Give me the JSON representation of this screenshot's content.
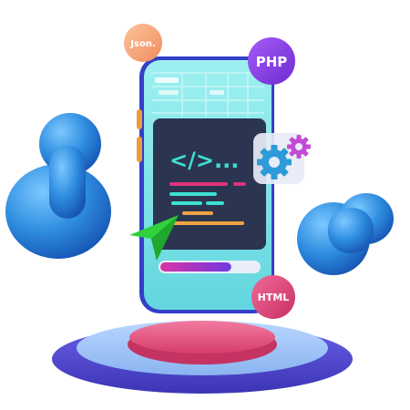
{
  "badges": {
    "json": "Json.",
    "php": "PHP",
    "html": "HTML"
  },
  "code_screen": {
    "code_symbol": "</>..."
  },
  "progress": {
    "fraction": 0.72
  },
  "icons": {
    "gears": "gears-icon",
    "cursor": "cursor-arrow-icon"
  },
  "colors": {
    "phone_frame": "#3c4cdc",
    "phone_screen_top": "#8fe8ea",
    "code_panel": "#2b3550",
    "accent_cyan": "#3ee0d2",
    "accent_pink": "#e0337c",
    "accent_orange": "#f0a342",
    "php_purple": "#8a3fe6",
    "html_pink": "#e0457c",
    "json_peach": "#f6a77c",
    "platform_pink": "#e8557d",
    "platform_blue": "#4a5bd6",
    "blob_blue": "#2e8de0",
    "cursor_green": "#2fd13c"
  }
}
